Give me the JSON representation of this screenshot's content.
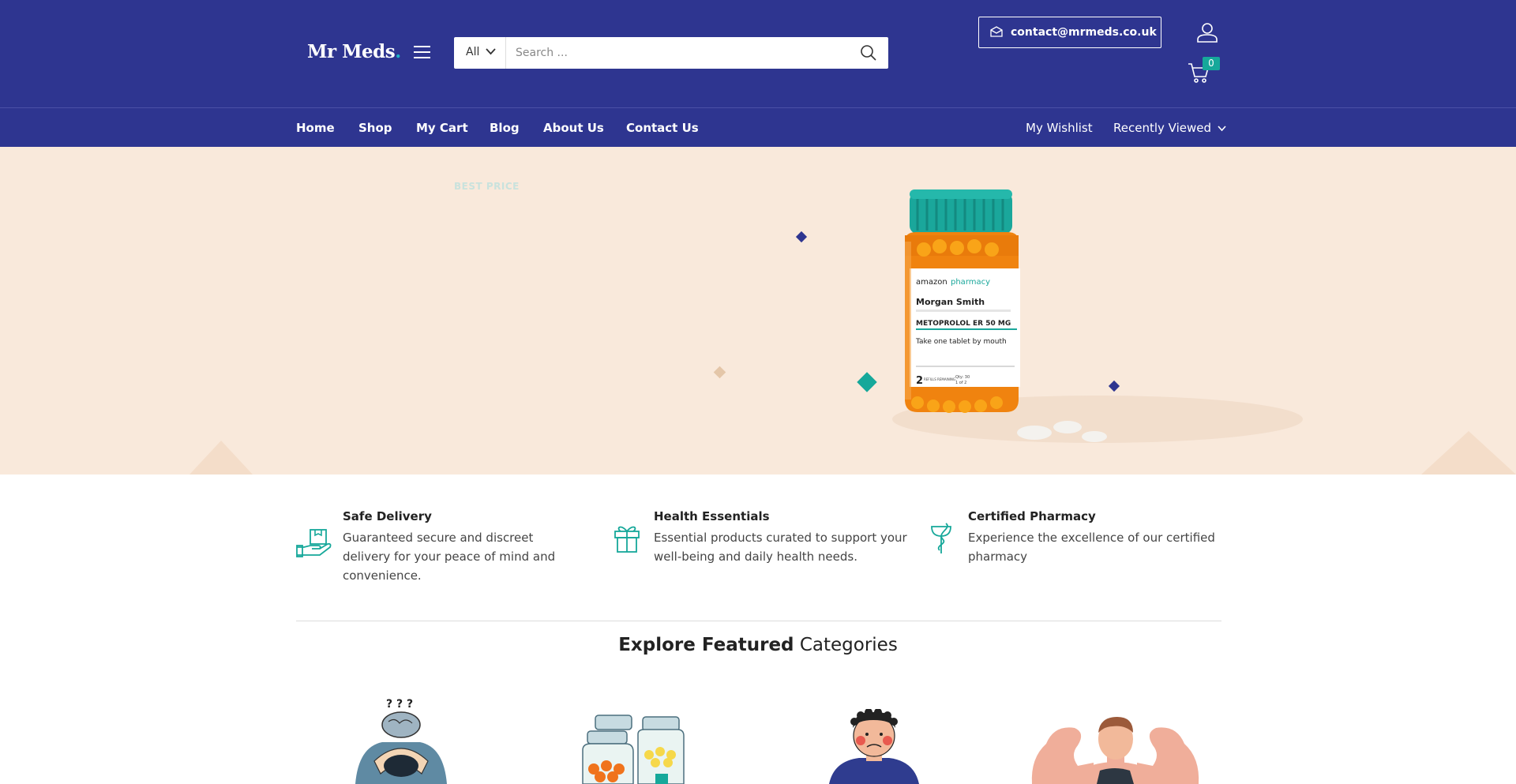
{
  "header": {
    "logo_text": "Mr Meds",
    "logo_dot": ".",
    "search": {
      "category": "All",
      "placeholder": "Search ..."
    },
    "contact_email": "contact@mrmeds.co.uk",
    "cart_count": "0"
  },
  "nav": {
    "items": [
      "Home",
      "Shop",
      "My Cart",
      "Blog",
      "About Us",
      "Contact Us"
    ],
    "wishlist": "My Wishlist",
    "recently_viewed": "Recently Viewed"
  },
  "hero": {
    "eyebrow": "BEST PRICE",
    "bottle_label": {
      "brand_a": "amazon",
      "brand_b": "pharmacy",
      "patient": "Morgan Smith",
      "drug": "METOPROLOL ER 50 MG",
      "instructions": "Take one tablet by mouth",
      "refills": "2",
      "refills_text": "REFILLS REMAINING",
      "qty": "Qty: 30",
      "fill": "1 of 2"
    }
  },
  "features": [
    {
      "title": "Safe Delivery",
      "desc": "Guaranteed secure and discreet delivery for your peace of mind and convenience.",
      "icon": "hand-box-icon"
    },
    {
      "title": "Health Essentials",
      "desc": "Essential products curated to support your well-being and daily health needs.",
      "icon": "gift-icon"
    },
    {
      "title": "Certified Pharmacy",
      "desc": "Experience the excellence of our certified pharmacy",
      "icon": "caduceus-icon"
    }
  ],
  "section": {
    "title_bold": "Explore Featured",
    "title_rest": "Categories"
  },
  "categories": [
    {
      "icon": "anxiety-brain-icon"
    },
    {
      "icon": "pill-bottles-icon"
    },
    {
      "icon": "sad-man-icon"
    },
    {
      "icon": "muscle-man-icon"
    }
  ],
  "colors": {
    "header_bg": "#2e3590",
    "accent_teal": "#16a89a",
    "hero_bg": "#f9e9db"
  }
}
